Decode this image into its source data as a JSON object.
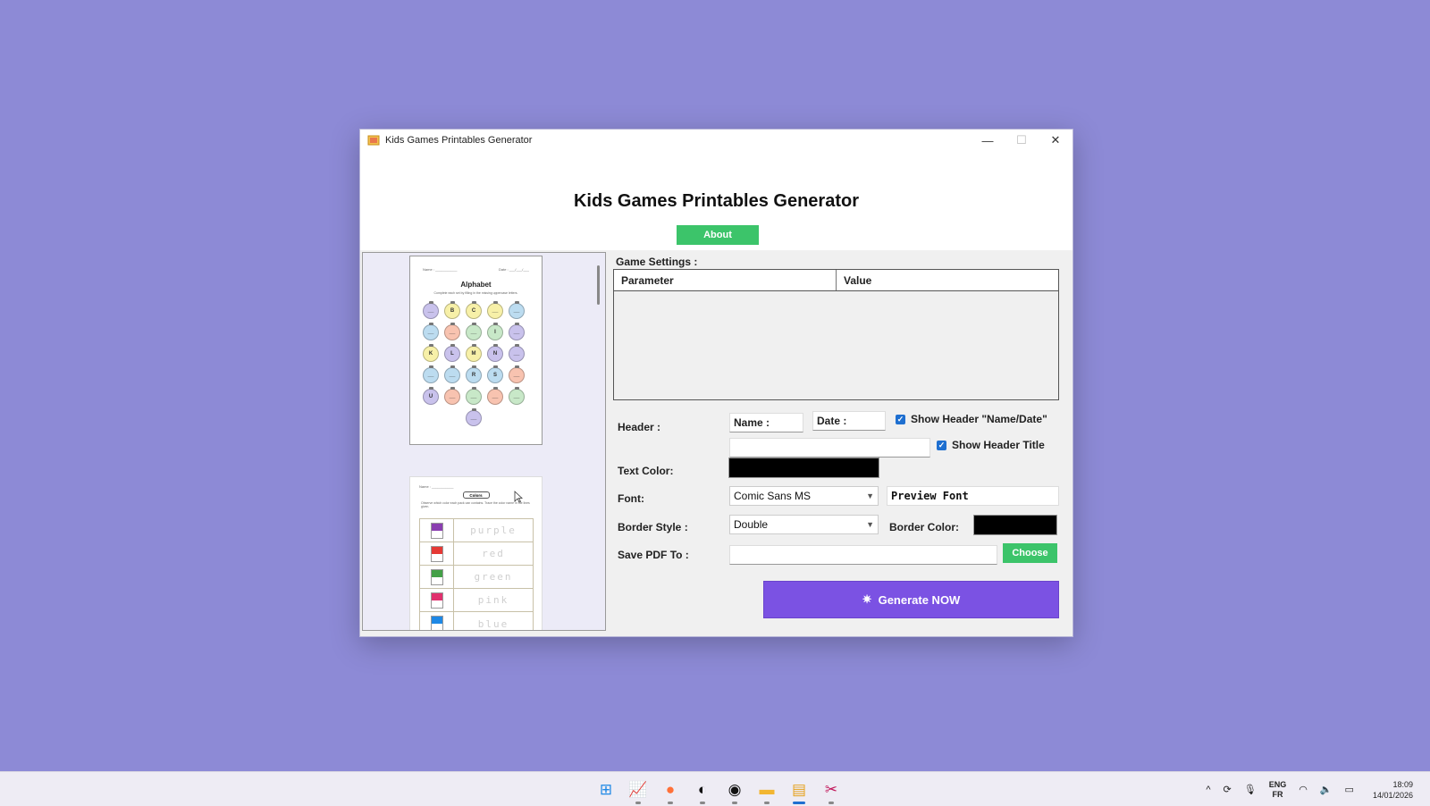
{
  "window": {
    "title": "Kids Games Printables Generator",
    "controls": {
      "minimize": "—",
      "maximize": "☐",
      "close": "✕"
    }
  },
  "header": {
    "title": "Kids Games Printables Generator",
    "about_label": "About"
  },
  "preview": {
    "page1": {
      "name_label": "Name : ___________",
      "date_label": "Date : ___/___/___",
      "title": "Alphabet",
      "instructions": "Complete each set by filling in the missing uppercase letters.",
      "balls": [
        {
          "letter": "__",
          "color": "#c9c2ec"
        },
        {
          "letter": "B",
          "color": "#f7f0a8"
        },
        {
          "letter": "C",
          "color": "#f7f0a8"
        },
        {
          "letter": "__",
          "color": "#f7f0a8"
        },
        {
          "letter": "__",
          "color": "#bcdcf0"
        },
        {
          "letter": "__",
          "color": "#bcdcf0"
        },
        {
          "letter": "__",
          "color": "#f8c3b0"
        },
        {
          "letter": "__",
          "color": "#c8e8c8"
        },
        {
          "letter": "I",
          "color": "#c8e8c8"
        },
        {
          "letter": "__",
          "color": "#c9c2ec"
        },
        {
          "letter": "K",
          "color": "#f7f0a8"
        },
        {
          "letter": "L",
          "color": "#c9c2ec"
        },
        {
          "letter": "M",
          "color": "#f7f0a8"
        },
        {
          "letter": "N",
          "color": "#c9c2ec"
        },
        {
          "letter": "__",
          "color": "#c9c2ec"
        },
        {
          "letter": "__",
          "color": "#bcdcf0"
        },
        {
          "letter": "__",
          "color": "#bcdcf0"
        },
        {
          "letter": "R",
          "color": "#bcdcf0"
        },
        {
          "letter": "S",
          "color": "#bcdcf0"
        },
        {
          "letter": "__",
          "color": "#f8c3b0"
        },
        {
          "letter": "U",
          "color": "#c9c2ec"
        },
        {
          "letter": "__",
          "color": "#f8c3b0"
        },
        {
          "letter": "__",
          "color": "#c8e8c8"
        },
        {
          "letter": "__",
          "color": "#f8c3b0"
        },
        {
          "letter": "__",
          "color": "#c8e8c8"
        },
        {
          "letter": "__",
          "color": "#c9c2ec"
        }
      ]
    },
    "page2": {
      "name_label": "Name : ___________",
      "title": "Colors",
      "instructions": "Observe which color each pack can contains. Trace the color name in the lines given.",
      "rows": [
        {
          "word": "purple",
          "color": "#8a3fb0"
        },
        {
          "word": "red",
          "color": "#e53935"
        },
        {
          "word": "green",
          "color": "#43a047"
        },
        {
          "word": "pink",
          "color": "#e0316e"
        },
        {
          "word": "blue",
          "color": "#1e88e5"
        }
      ]
    }
  },
  "settings": {
    "section_label": "Game Settings :",
    "table_headers": [
      "Parameter",
      "Value"
    ],
    "header_label": "Header :",
    "name_field": "Name :",
    "date_field": "Date :",
    "show_header_namedate": "Show Header \"Name/Date\"",
    "header_title_value": "",
    "show_header_title": "Show Header Title",
    "text_color_label": "Text Color:",
    "text_color": "#000000",
    "font_label": "Font:",
    "font_value": "Comic Sans MS",
    "preview_font": "Preview Font",
    "border_style_label": "Border Style :",
    "border_style_value": "Double",
    "border_color_label": "Border Color:",
    "border_color": "#000000",
    "save_pdf_label": "Save PDF To :",
    "save_pdf_value": "",
    "choose_label": "Choose",
    "generate_label": "Generate NOW"
  },
  "taskbar": {
    "apps": [
      {
        "name": "start",
        "glyph": "⊞",
        "color": "#1e88e5"
      },
      {
        "name": "app-chart",
        "glyph": "📈",
        "color": "#4caf50"
      },
      {
        "name": "firefox",
        "glyph": "●",
        "color": "#ff7139"
      },
      {
        "name": "app-moon",
        "glyph": "◐",
        "color": "#111111"
      },
      {
        "name": "obs",
        "glyph": "◉",
        "color": "#111111"
      },
      {
        "name": "file-explorer",
        "glyph": "▬",
        "color": "#f2b632"
      },
      {
        "name": "kids-games-app",
        "glyph": "▤",
        "color": "#e6a21e"
      },
      {
        "name": "snipping-tool",
        "glyph": "✂",
        "color": "#c2185b"
      }
    ],
    "tray": {
      "chevron": "^",
      "lang_top": "ENG",
      "lang_bottom": "FR",
      "time": "18:09",
      "date": "14/01/2026"
    }
  }
}
